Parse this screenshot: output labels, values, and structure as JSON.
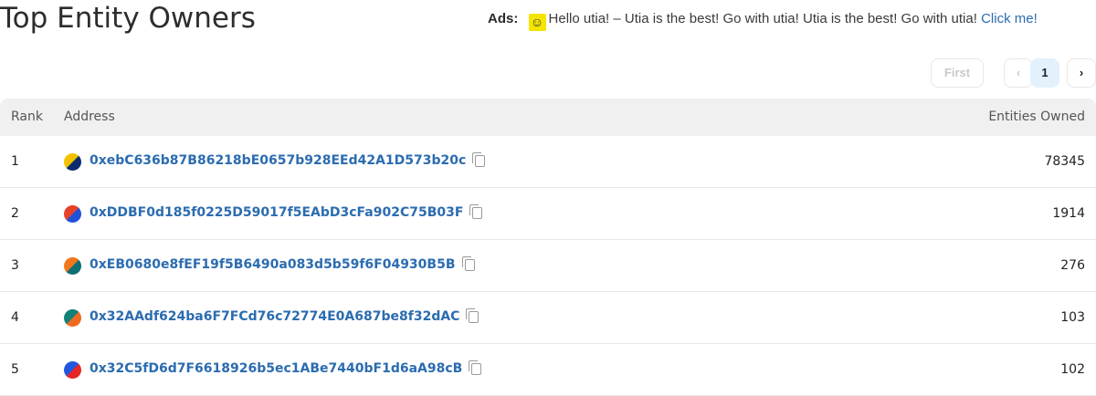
{
  "page": {
    "title": "Top Entity Owners"
  },
  "ads": {
    "label": "Ads:",
    "icon": "smiley-duck-icon",
    "text": "Hello utia! – Utia is the best! Go with utia! Utia is the best! Go with utia!",
    "link": "Click me!"
  },
  "pagination": {
    "first": "First",
    "prev": "‹",
    "current": "1",
    "next": "›"
  },
  "table": {
    "headers": {
      "rank": "Rank",
      "address": "Address",
      "owned": "Entities Owned"
    },
    "rows": [
      {
        "rank": "1",
        "address": "0xebC636b87B86218bE0657b928EEd42A1D573b20c",
        "owned": "78345",
        "avatar_colors": [
          "#f2c200",
          "#0b2a6f"
        ]
      },
      {
        "rank": "2",
        "address": "0xDDBF0d185f0225D59017f5EAbD3cFa902C75B03F",
        "owned": "1914",
        "avatar_colors": [
          "#e8412a",
          "#2151d8"
        ]
      },
      {
        "rank": "3",
        "address": "0xEB0680e8fEF19f5B6490a083d5b59f6F04930B5B",
        "owned": "276",
        "avatar_colors": [
          "#f2771c",
          "#0e6f74"
        ]
      },
      {
        "rank": "4",
        "address": "0x32AAdf624ba6F7FCd76c72774E0A687be8f32dAC",
        "owned": "103",
        "avatar_colors": [
          "#138077",
          "#ef6a1f"
        ]
      },
      {
        "rank": "5",
        "address": "0x32C5fD6d7F6618926b5ec1ABe7440bF1d6aA98cB",
        "owned": "102",
        "avatar_colors": [
          "#1f57e0",
          "#e82525"
        ]
      }
    ]
  }
}
